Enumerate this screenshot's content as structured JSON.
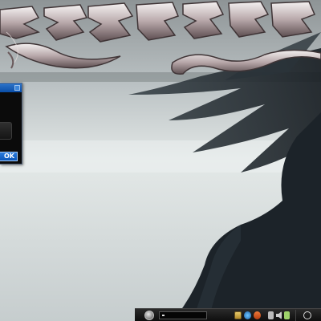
{
  "dialog": {
    "ok_label": "OK"
  },
  "taskbar": {
    "start_icon": "start-orb-icon",
    "tray_icons": [
      "folder-icon",
      "browser-icon",
      "media-player-icon",
      "network-icon",
      "volume-icon",
      "tray-app-icon",
      "clock-icon"
    ]
  },
  "colors": {
    "dialog_title": "#1a62c0",
    "dialog_body": "#0b0b0b",
    "taskbar": "#1a1a1a",
    "wallpaper_sky": "#c9d1d2",
    "wallpaper_silhouette": "#1f262c"
  }
}
